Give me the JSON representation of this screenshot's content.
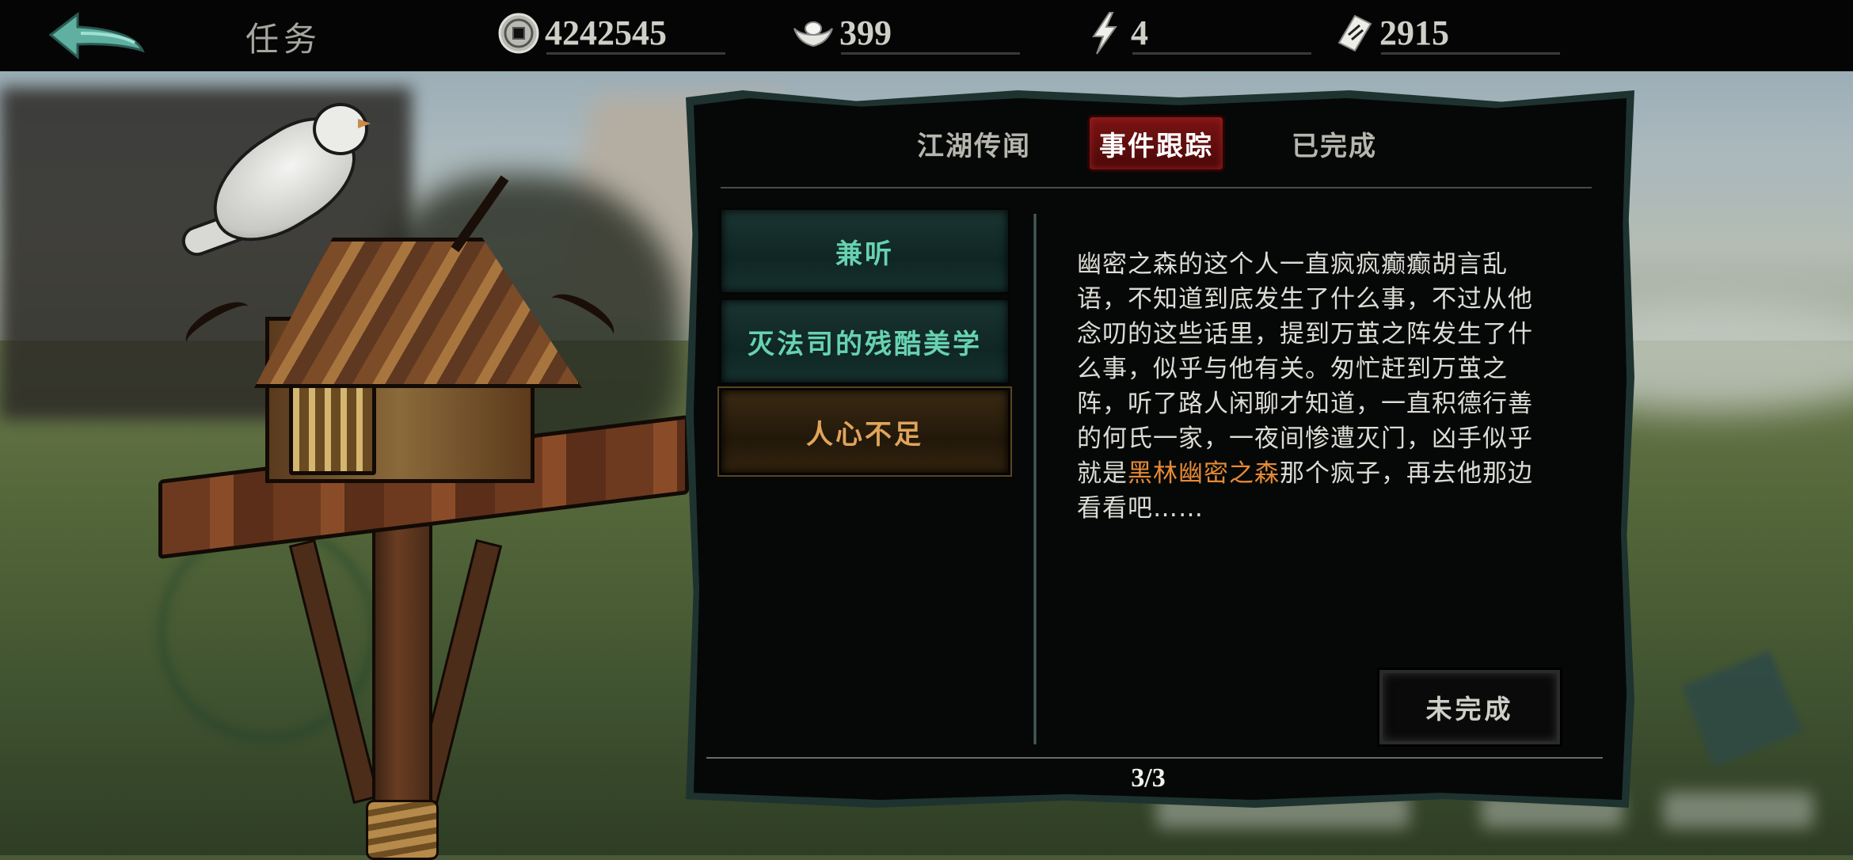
{
  "header": {
    "title": "任务",
    "resources": [
      {
        "icon": "copper-coin-icon",
        "value": "4242545"
      },
      {
        "icon": "silver-ingot-icon",
        "value": "399"
      },
      {
        "icon": "lightning-icon",
        "value": "4"
      },
      {
        "icon": "ticket-icon",
        "value": "2915"
      }
    ]
  },
  "tabs": [
    {
      "label": "江湖传闻",
      "active": false
    },
    {
      "label": "事件跟踪",
      "active": true
    },
    {
      "label": "已完成",
      "active": false
    }
  ],
  "quests": [
    {
      "label": "兼听",
      "style": "teal"
    },
    {
      "label": "灭法司的残酷美学",
      "style": "teal"
    },
    {
      "label": "人心不足",
      "style": "gold",
      "selected": true
    }
  ],
  "description": {
    "text_before": "幽密之森的这个人一直疯疯癫癫胡言乱语，不知道到底发生了什么事，不过从他念叨的这些话里，提到万茧之阵发生了什么事，似乎与他有关。匆忙赶到万茧之阵，听了路人闲聊才知道，一直积德行善的何氏一家，一夜间惨遭灭门，凶手似乎就是",
    "highlight": "黑林幽密之森",
    "text_after": "那个疯子，再去他那边看看吧……"
  },
  "status_button": "未完成",
  "pager": "3/3",
  "colors": {
    "active_tab": "#7a1414",
    "quest_teal_text": "#67d2b0",
    "quest_gold_text": "#e0a45a",
    "highlight": "#e48a36"
  }
}
